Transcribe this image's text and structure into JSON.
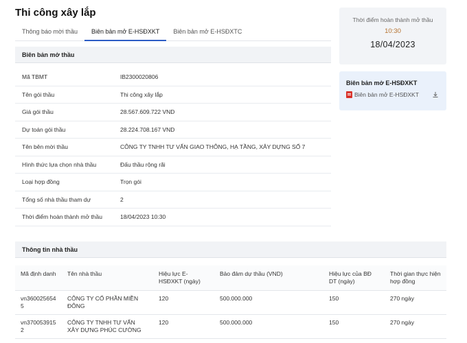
{
  "page_title": "Thi công xây lắp",
  "tabs": [
    {
      "label": "Thông báo mời thầu"
    },
    {
      "label": "Biên bản mở E-HSĐXKT"
    },
    {
      "label": "Biên bản mở E-HSĐXTC"
    }
  ],
  "minutes_section": {
    "title": "Biên bản mở thầu",
    "rows": [
      {
        "label": "Mã TBMT",
        "value": "IB2300020806"
      },
      {
        "label": "Tên gói thầu",
        "value": "Thi công xây lắp"
      },
      {
        "label": "Giá gói thầu",
        "value": "28.567.609.722 VND"
      },
      {
        "label": "Dự toán gói thầu",
        "value": "28.224.708.167 VND"
      },
      {
        "label": "Tên bên mời thầu",
        "value": "CÔNG TY TNHH TƯ VẤN GIAO THÔNG, HẠ TẦNG, XÂY DỰNG SỐ 7"
      },
      {
        "label": "Hình thức lựa chọn nhà thầu",
        "value": "Đấu thầu rộng rãi"
      },
      {
        "label": "Loại hợp đồng",
        "value": "Trọn gói"
      },
      {
        "label": "Tổng số nhà thầu tham dự",
        "value": "2"
      },
      {
        "label": "Thời điểm hoàn thành mở thầu",
        "value": "18/04/2023 10:30"
      }
    ]
  },
  "completion_card": {
    "label": "Thời điểm hoàn thành mở thầu",
    "time": "10:30",
    "date": "18/04/2023"
  },
  "document_card": {
    "title": "Biên bản mở E-HSĐXKT",
    "file_label": "Biên bản mở E-HSĐXKT",
    "file_icon": "pdf-icon",
    "action_icon": "download-icon"
  },
  "bidders_section": {
    "title": "Thông tin nhà thầu",
    "columns": [
      "Mã định danh",
      "Tên nhà thầu",
      "Hiệu lực E-HSĐXKT (ngày)",
      "Bảo đảm dự thầu (VND)",
      "Hiệu lực của BĐ DT (ngày)",
      "Thời gian thực hiện hợp đồng"
    ],
    "rows": [
      [
        "vn3600256545",
        "CÔNG TY CỔ PHẦN MIỀN ĐÔNG",
        "120",
        "500.000.000",
        "150",
        "270 ngày"
      ],
      [
        "vn3700539152",
        "CÔNG TY TNHH TƯ VẤN XÂY DỰNG PHÚC CƯỜNG",
        "120",
        "500.000.000",
        "150",
        "270 ngày"
      ]
    ]
  }
}
